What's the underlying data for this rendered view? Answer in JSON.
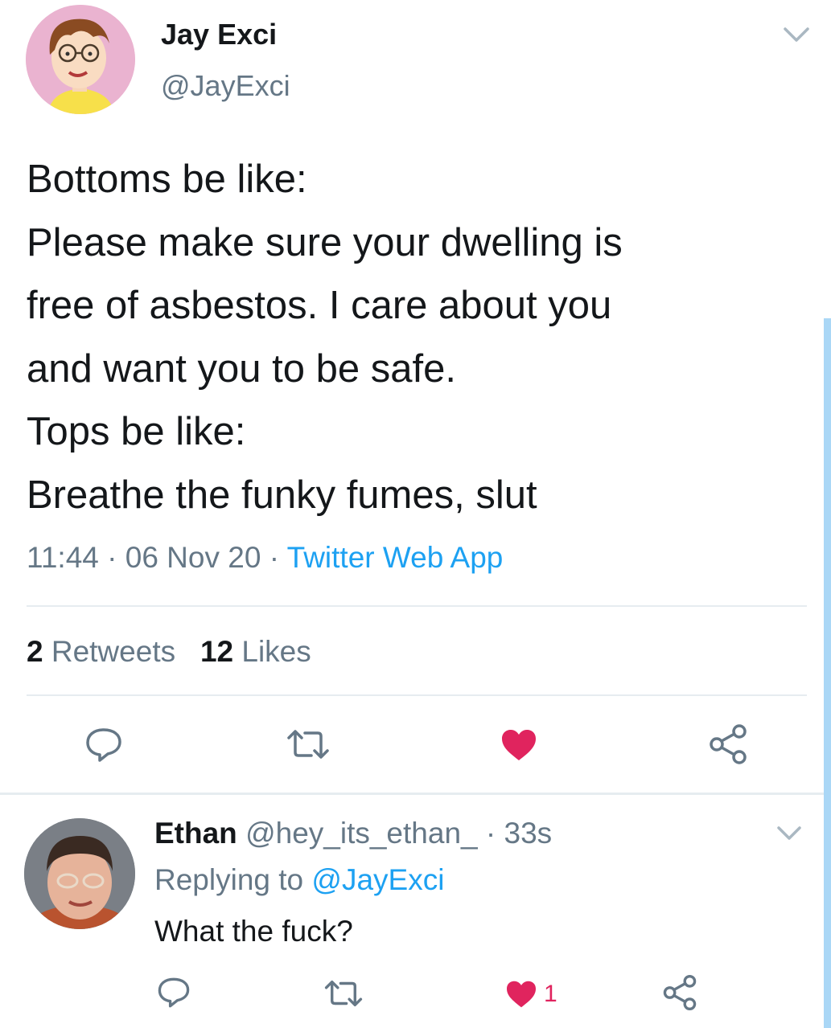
{
  "tweet": {
    "author_name": "Jay Exci",
    "author_handle": "@JayExci",
    "avatar_icon": "cartoon-avatar",
    "menu_icon": "chevron-down-icon",
    "text_lines": [
      "Bottoms be like:",
      "Please make sure your dwelling is",
      "free of asbestos. I care about you",
      "and want you to be safe.",
      "Tops be like:",
      "Breathe the funky fumes, slut"
    ],
    "time": "11:44",
    "separator": " · ",
    "date": "06 Nov 20",
    "source": "Twitter Web App",
    "retweets_count": "2",
    "retweets_label": "Retweets",
    "likes_count": "12",
    "likes_label": "Likes",
    "actions": {
      "reply_icon": "reply-icon",
      "retweet_icon": "retweet-icon",
      "like_icon": "heart-icon",
      "share_icon": "share-icon"
    }
  },
  "reply": {
    "author_name": "Ethan",
    "author_handle": "@hey_its_ethan_",
    "time": "33s",
    "separator": " · ",
    "replying_prefix": "Replying to ",
    "replying_to": "@JayExci",
    "text": "What the fuck?",
    "like_count": "1"
  },
  "colors": {
    "accent": "#1da1f2",
    "like": "#e0245e",
    "muted": "#657786",
    "divider": "#e6ecf0"
  }
}
